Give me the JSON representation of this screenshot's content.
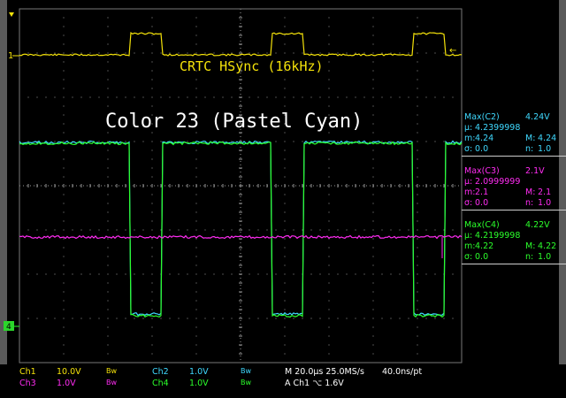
{
  "colors": {
    "ch1": "#f4e20a",
    "ch2": "#3fd9ff",
    "ch3": "#ff2cf2",
    "ch4": "#2bff2b",
    "grid": "#9a9a9a",
    "bezel": "#6e6e6e",
    "text_white": "#ffffff"
  },
  "annotations": {
    "hsync_label": "CRTC HSync (16kHz)",
    "color_label": "Color 23 (Pastel Cyan)"
  },
  "markers": {
    "ch1_ground": "1",
    "ch4_ground": "4"
  },
  "measurements": [
    {
      "header": "Max(C2)",
      "value": "4.24V",
      "mean_label": "µ:",
      "mean": "4.2399998",
      "min_label": "m:",
      "min": "4.24",
      "max_label": "M:",
      "max": "4.24",
      "sigma_label": "σ:",
      "sigma": "0.0",
      "n_label": "n:",
      "n": "1.0",
      "color": "#3fd9ff"
    },
    {
      "header": "Max(C3)",
      "value": "2.1V",
      "mean_label": "µ:",
      "mean": "2.0999999",
      "min_label": "m:",
      "min": "2.1",
      "max_label": "M:",
      "max": "2.1",
      "sigma_label": "σ:",
      "sigma": "0.0",
      "n_label": "n:",
      "n": "1.0",
      "color": "#ff2cf2"
    },
    {
      "header": "Max(C4)",
      "value": "4.22V",
      "mean_label": "µ:",
      "mean": "4.2199998",
      "min_label": "m:",
      "min": "4.22",
      "max_label": "M:",
      "max": "4.22",
      "sigma_label": "σ:",
      "sigma": "0.0",
      "n_label": "n:",
      "n": "1.0",
      "color": "#2bff2b"
    }
  ],
  "status": {
    "ch1_label": "Ch1",
    "ch1_scale": "10.0V",
    "ch1_bw": "Bw",
    "ch2_label": "Ch2",
    "ch2_scale": "1.0V",
    "ch2_bw": "Bw",
    "ch3_label": "Ch3",
    "ch3_scale": "1.0V",
    "ch3_bw": "Bw",
    "ch4_label": "Ch4",
    "ch4_scale": "1.0V",
    "ch4_bw": "Bw",
    "timebase": "M 20.0µs 25.0MS/s",
    "sample_interval": "40.0ns/pt",
    "trigger": "A  Ch1  ⌥  1.6V"
  }
}
